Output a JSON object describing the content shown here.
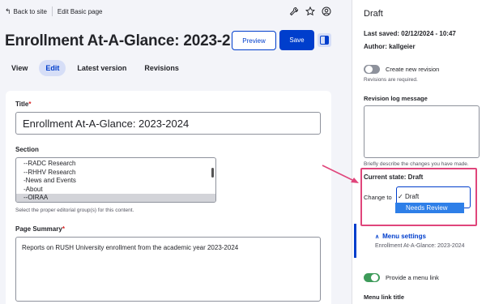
{
  "topbar": {
    "back_label": "Back to site",
    "edit_label": "Edit Basic page",
    "tool_icons": [
      "wrench-icon",
      "star-icon",
      "user-icon"
    ]
  },
  "header": {
    "title": "Enrollment At-A-Glance: 2023-2…",
    "preview_label": "Preview",
    "save_label": "Save"
  },
  "tabs": [
    {
      "label": "View",
      "active": false
    },
    {
      "label": "Edit",
      "active": true
    },
    {
      "label": "Latest version",
      "active": false
    },
    {
      "label": "Revisions",
      "active": false
    }
  ],
  "form": {
    "title_label": "Title",
    "title_value": "Enrollment At-A-Glance: 2023-2024",
    "section_label": "Section",
    "section_options": [
      "--RADC Research",
      "--RHHV Research",
      "-News and Events",
      "-About",
      "--OIRAA"
    ],
    "section_selected": "--OIRAA",
    "section_help": "Select the proper editorial group(s) for this content.",
    "summary_label": "Page Summary",
    "summary_value": "Reports on RUSH University enrollment from the academic year 2023-2024"
  },
  "sidebar": {
    "status_heading": "Draft",
    "last_saved": "Last saved: 02/12/2024 - 10:47",
    "author": "Author: kallgeier",
    "create_revision_label": "Create new revision",
    "revisions_required": "Revisions are required.",
    "revision_log_label": "Revision log message",
    "revision_log_help": "Briefly describe the changes you have made.",
    "current_state": "Current state: Draft",
    "change_to_label": "Change to",
    "change_to_options": [
      "Draft",
      "Needs Review"
    ],
    "change_to_checked": "✓",
    "menu_settings_label": "Menu settings",
    "menu_settings_value": "Enrollment At-A-Glance: 2023-2024",
    "provide_menu_label": "Provide a menu link",
    "menu_link_title_label": "Menu link title"
  },
  "colors": {
    "accent": "#003ecc",
    "highlight": "#e0457b",
    "toggle_on": "#3e9b5a",
    "toggle_off": "#8e929c"
  }
}
